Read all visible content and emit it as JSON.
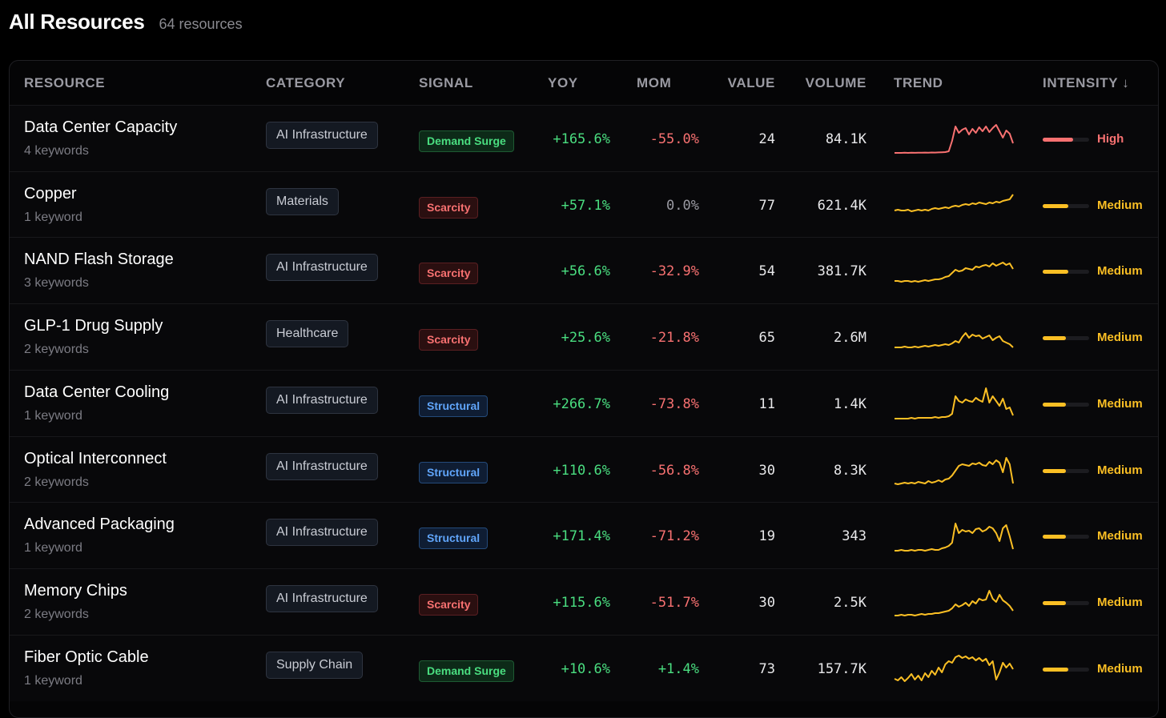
{
  "header": {
    "title": "All Resources",
    "count": "64 resources"
  },
  "columns": {
    "resource": "RESOURCE",
    "category": "CATEGORY",
    "signal": "SIGNAL",
    "yoy": "YOY",
    "mom": "MOM",
    "value": "VALUE",
    "volume": "VOLUME",
    "trend": "TREND",
    "intensity": "INTENSITY ↓"
  },
  "colors": {
    "high": "#f87171",
    "medium": "#fbbf24",
    "positive": "#4ade80",
    "negative": "#f87171"
  },
  "rows": [
    {
      "name": "Data Center Capacity",
      "keywords": "4 keywords",
      "category": "AI Infrastructure",
      "signal": "Demand Surge",
      "signal_type": "demand",
      "yoy": "+165.6%",
      "mom": "-55.0%",
      "mom_sign": "neg",
      "value": "24",
      "volume": "84.1K",
      "intensity_label": "High",
      "intensity_level": "high",
      "intensity_fill": 0.65,
      "trend": [
        3,
        3,
        3,
        3.2,
        3,
        3.3,
        3.1,
        3.3,
        3.2,
        3.4,
        3.3,
        3.5,
        3.4,
        3.6,
        3.8,
        4,
        5,
        18,
        36,
        28,
        32,
        34,
        26,
        33,
        28,
        35,
        30,
        36,
        29,
        34,
        38,
        30,
        22,
        31,
        27,
        15
      ]
    },
    {
      "name": "Copper",
      "keywords": "1 keyword",
      "category": "Materials",
      "signal": "Scarcity",
      "signal_type": "scarcity",
      "yoy": "+57.1%",
      "mom": "0.0%",
      "mom_sign": "zero",
      "value": "77",
      "volume": "621.4K",
      "intensity_label": "Medium",
      "intensity_level": "medium",
      "intensity_fill": 0.55,
      "trend": [
        14,
        15,
        14,
        14,
        15,
        13,
        14,
        15,
        14,
        15,
        14,
        16,
        17,
        16,
        17,
        18,
        17,
        19,
        20,
        19,
        21,
        22,
        21,
        23,
        22,
        24,
        23,
        22,
        24,
        23,
        25,
        24,
        26,
        27,
        28,
        34
      ]
    },
    {
      "name": "NAND Flash Storage",
      "keywords": "3 keywords",
      "category": "AI Infrastructure",
      "signal": "Scarcity",
      "signal_type": "scarcity",
      "yoy": "+56.6%",
      "mom": "-32.9%",
      "mom_sign": "neg",
      "value": "54",
      "volume": "381.7K",
      "intensity_label": "Medium",
      "intensity_level": "medium",
      "intensity_fill": 0.55,
      "trend": [
        8,
        8,
        7,
        8,
        8,
        7,
        8,
        7,
        8,
        9,
        8,
        9,
        10,
        10,
        11,
        13,
        14,
        18,
        22,
        20,
        21,
        24,
        23,
        22,
        26,
        25,
        27,
        28,
        26,
        30,
        27,
        29,
        31,
        28,
        30,
        23
      ]
    },
    {
      "name": "GLP-1 Drug Supply",
      "keywords": "2 keywords",
      "category": "Healthcare",
      "signal": "Scarcity",
      "signal_type": "scarcity",
      "yoy": "+25.6%",
      "mom": "-21.8%",
      "mom_sign": "neg",
      "value": "65",
      "volume": "2.6M",
      "intensity_label": "Medium",
      "intensity_level": "medium",
      "intensity_fill": 0.5,
      "trend": [
        8,
        8,
        8,
        9,
        8,
        8,
        9,
        8,
        9,
        10,
        9,
        10,
        11,
        10,
        11,
        12,
        11,
        13,
        16,
        14,
        21,
        26,
        20,
        24,
        22,
        23,
        19,
        21,
        23,
        17,
        20,
        22,
        16,
        14,
        12,
        8
      ]
    },
    {
      "name": "Data Center Cooling",
      "keywords": "1 keyword",
      "category": "AI Infrastructure",
      "signal": "Structural",
      "signal_type": "structural",
      "yoy": "+266.7%",
      "mom": "-73.8%",
      "mom_sign": "neg",
      "value": "11",
      "volume": "1.4K",
      "intensity_label": "Medium",
      "intensity_level": "medium",
      "intensity_fill": 0.5,
      "trend": [
        2,
        2,
        2,
        2,
        2,
        3,
        2,
        3,
        3,
        3,
        3,
        3,
        4,
        3,
        4,
        4,
        5,
        8,
        30,
        24,
        22,
        26,
        24,
        23,
        28,
        25,
        23,
        40,
        22,
        30,
        24,
        18,
        27,
        14,
        16,
        6
      ]
    },
    {
      "name": "Optical Interconnect",
      "keywords": "2 keywords",
      "category": "AI Infrastructure",
      "signal": "Structural",
      "signal_type": "structural",
      "yoy": "+110.6%",
      "mom": "-56.8%",
      "mom_sign": "neg",
      "value": "30",
      "volume": "8.3K",
      "intensity_label": "Medium",
      "intensity_level": "medium",
      "intensity_fill": 0.5,
      "trend": [
        4,
        3,
        4,
        5,
        4,
        5,
        4,
        6,
        5,
        4,
        7,
        5,
        6,
        8,
        6,
        9,
        10,
        14,
        20,
        26,
        28,
        27,
        26,
        29,
        28,
        30,
        27,
        26,
        31,
        28,
        33,
        30,
        18,
        36,
        28,
        4
      ]
    },
    {
      "name": "Advanced Packaging",
      "keywords": "1 keyword",
      "category": "AI Infrastructure",
      "signal": "Structural",
      "signal_type": "structural",
      "yoy": "+171.4%",
      "mom": "-71.2%",
      "mom_sign": "neg",
      "value": "19",
      "volume": "343",
      "intensity_label": "Medium",
      "intensity_level": "medium",
      "intensity_fill": 0.5,
      "trend": [
        2,
        2,
        3,
        2,
        2,
        3,
        2,
        3,
        3,
        2,
        3,
        4,
        3,
        3,
        5,
        6,
        8,
        12,
        36,
        24,
        28,
        26,
        27,
        24,
        29,
        30,
        26,
        28,
        32,
        30,
        24,
        14,
        30,
        34,
        20,
        4
      ]
    },
    {
      "name": "Memory Chips",
      "keywords": "2 keywords",
      "category": "AI Infrastructure",
      "signal": "Scarcity",
      "signal_type": "scarcity",
      "yoy": "+115.6%",
      "mom": "-51.7%",
      "mom_sign": "neg",
      "value": "30",
      "volume": "2.5K",
      "intensity_label": "Medium",
      "intensity_level": "medium",
      "intensity_fill": 0.5,
      "trend": [
        4,
        4,
        5,
        4,
        5,
        5,
        4,
        5,
        6,
        5,
        6,
        6,
        7,
        7,
        8,
        9,
        10,
        13,
        18,
        15,
        17,
        20,
        16,
        22,
        19,
        25,
        23,
        24,
        35,
        25,
        21,
        30,
        23,
        20,
        16,
        10
      ]
    },
    {
      "name": "Fiber Optic Cable",
      "keywords": "1 keyword",
      "category": "Supply Chain",
      "signal": "Demand Surge",
      "signal_type": "demand",
      "yoy": "+10.6%",
      "mom": "+1.4%",
      "mom_sign": "pos",
      "value": "73",
      "volume": "157.7K",
      "intensity_label": "Medium",
      "intensity_level": "medium",
      "intensity_fill": 0.55,
      "trend": [
        8,
        6,
        10,
        5,
        9,
        14,
        7,
        12,
        6,
        15,
        10,
        18,
        13,
        22,
        16,
        26,
        30,
        28,
        35,
        37,
        34,
        36,
        33,
        35,
        31,
        34,
        30,
        33,
        25,
        30,
        7,
        16,
        28,
        22,
        27,
        20
      ]
    }
  ]
}
